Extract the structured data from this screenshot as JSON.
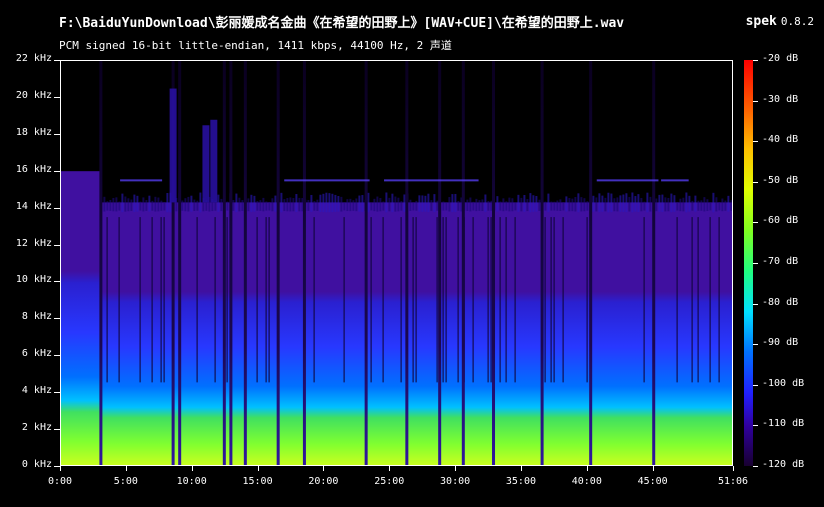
{
  "header": {
    "file_path": "F:\\BaiduYunDownload\\彭丽媛成名金曲《在希望的田野上》[WAV+CUE]\\在希望的田野上.wav",
    "stream_info": "PCM signed 16-bit little-endian, 1411 kbps, 44100 Hz, 2 声道",
    "app_name": "spek",
    "app_version": "0.8.2"
  },
  "chart_data": {
    "type": "heatmap",
    "title": "",
    "xlabel": "",
    "ylabel": "",
    "x_ticks": [
      "0:00",
      "5:00",
      "10:00",
      "15:00",
      "20:00",
      "25:00",
      "30:00",
      "35:00",
      "40:00",
      "45:00",
      "51:06"
    ],
    "y_ticks": [
      "0 kHz",
      "2 kHz",
      "4 kHz",
      "6 kHz",
      "8 kHz",
      "10 kHz",
      "12 kHz",
      "14 kHz",
      "16 kHz",
      "18 kHz",
      "20 kHz",
      "22 kHz"
    ],
    "colorbar_ticks": [
      "-20 dB",
      "-30 dB",
      "-40 dB",
      "-50 dB",
      "-60 dB",
      "-70 dB",
      "-80 dB",
      "-90 dB",
      "-100 dB",
      "-110 dB",
      "-120 dB"
    ],
    "xlim_minutes": [
      0,
      51.1
    ],
    "ylim_khz": [
      0,
      22
    ],
    "dynamic_range_db": [
      -120,
      -20
    ],
    "grid": false,
    "colorbar_position": "right",
    "silence_gaps_minutes": [
      3.0,
      8.5,
      9.0,
      12.4,
      12.9,
      14.0,
      16.5,
      18.5,
      23.2,
      26.3,
      28.8,
      30.6,
      32.9,
      36.6,
      40.3,
      45.1
    ],
    "spectral_cutoff_khz": 14.3,
    "intro_cutoff_khz": 16.0
  }
}
